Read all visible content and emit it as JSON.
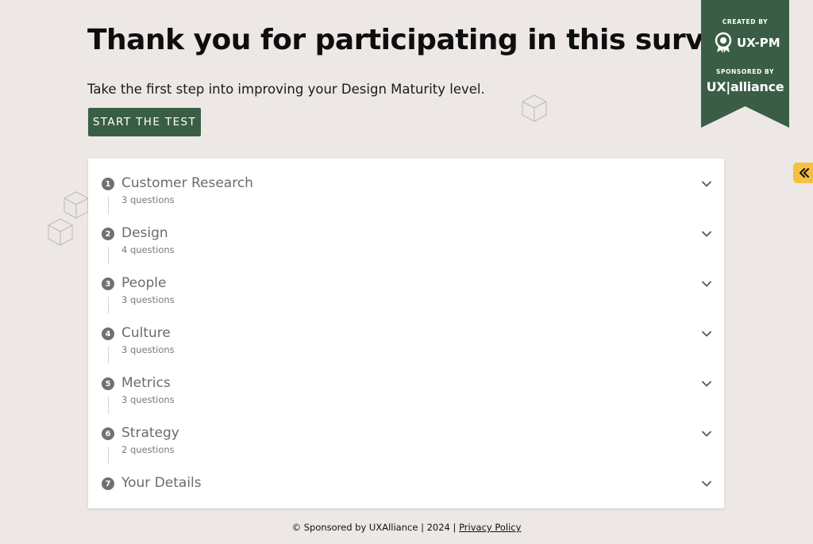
{
  "header": {
    "title": "Thank you for participating in this survey",
    "subtitle": "Take the first step into improving your Design Maturity level.",
    "start_button": "START THE TEST"
  },
  "badge": {
    "created_by": "CREATED BY",
    "created_brand": "UX-PM",
    "sponsored_by": "SPONSORED BY",
    "sponsored_brand": "UX|alliance",
    "color": "#3a5e45"
  },
  "sidebar_toggle": {
    "icon": "double-chevron-left-icon",
    "color": "#f6c142"
  },
  "sections": [
    {
      "number": "1",
      "title": "Customer Research",
      "subtitle": "3 questions"
    },
    {
      "number": "2",
      "title": "Design",
      "subtitle": "4 questions"
    },
    {
      "number": "3",
      "title": "People",
      "subtitle": "3 questions"
    },
    {
      "number": "4",
      "title": "Culture",
      "subtitle": "3 questions"
    },
    {
      "number": "5",
      "title": "Metrics",
      "subtitle": "3 questions"
    },
    {
      "number": "6",
      "title": "Strategy",
      "subtitle": "2 questions"
    },
    {
      "number": "7",
      "title": "Your Details",
      "subtitle": ""
    }
  ],
  "footer": {
    "text": "© Sponsored by UXAlliance | 2024 |",
    "link": "Privacy Policy"
  }
}
